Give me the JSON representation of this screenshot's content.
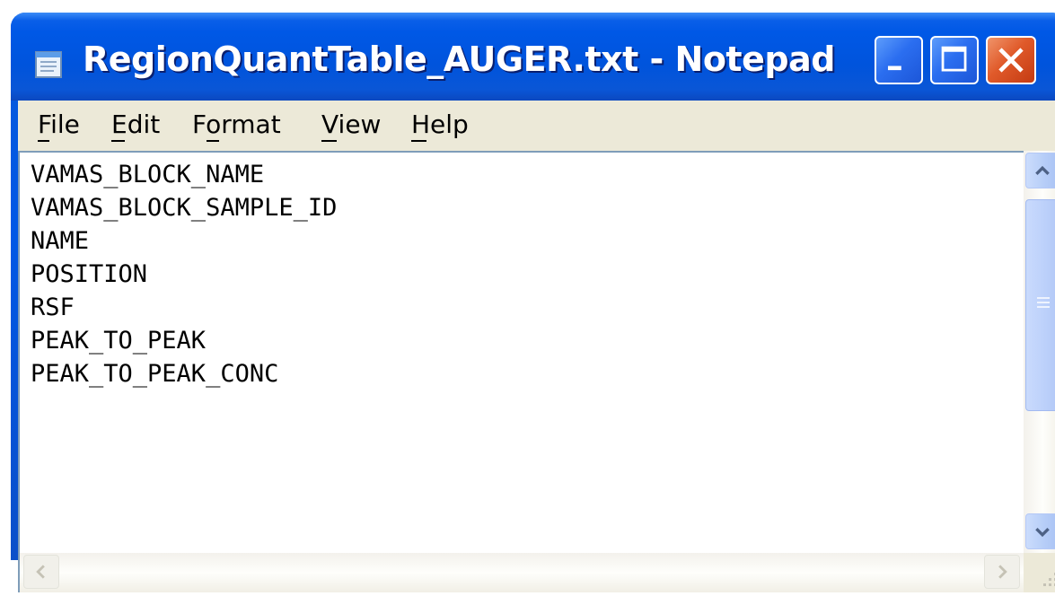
{
  "window": {
    "title": "RegionQuantTable_AUGER.txt - Notepad",
    "app_icon": "notepad-icon",
    "controls": [
      "minimize-icon",
      "maximize-icon",
      "close-icon"
    ],
    "colors": {
      "titlebar": "#0058e6",
      "close": "#e05a2a",
      "client": "#ece9d8"
    }
  },
  "menu": {
    "items": [
      {
        "label": "File",
        "accel": "F"
      },
      {
        "label": "Edit",
        "accel": "E"
      },
      {
        "label": "Format",
        "accel": "o"
      },
      {
        "label": "View",
        "accel": "V"
      },
      {
        "label": "Help",
        "accel": "H"
      }
    ]
  },
  "document": {
    "lines": [
      "VAMAS_BLOCK_NAME",
      "VAMAS_BLOCK_SAMPLE_ID",
      "NAME",
      "POSITION",
      "RSF",
      "PEAK_TO_PEAK",
      "PEAK_TO_PEAK_CONC"
    ]
  },
  "scrollbars": {
    "vertical": {
      "up": "chevron-up-icon",
      "down": "chevron-down-icon",
      "thumb": "scroll-thumb"
    },
    "horizontal": {
      "left": "chevron-left-icon",
      "right": "chevron-right-icon"
    }
  }
}
